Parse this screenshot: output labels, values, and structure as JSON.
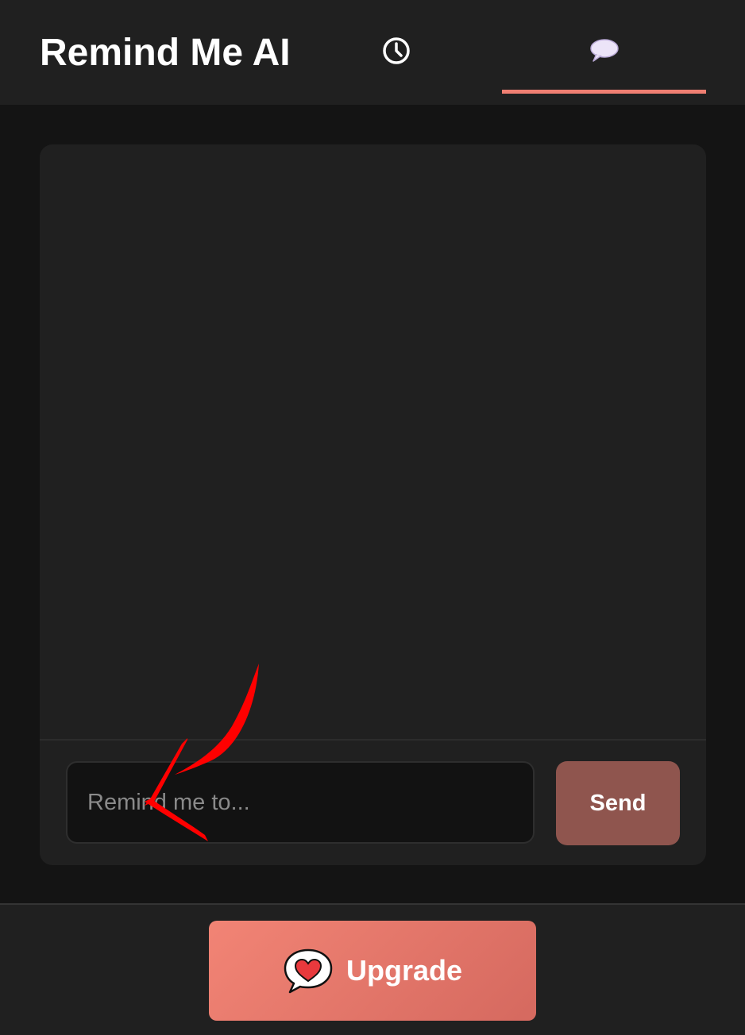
{
  "header": {
    "title": "Remind Me AI",
    "tabs": [
      {
        "icon": "clock-icon",
        "active": false
      },
      {
        "icon": "speech-bubble-icon",
        "active": true
      }
    ]
  },
  "chat": {
    "input_placeholder": "Remind me to...",
    "input_value": "",
    "send_label": "Send"
  },
  "footer": {
    "upgrade_label": "Upgrade",
    "upgrade_icon": "heart-speech-bubble-icon"
  },
  "colors": {
    "accent": "#f07f72",
    "send_button": "#8f554e",
    "background": "#141414",
    "surface": "#202020",
    "annotation_arrow": "#ff0000"
  }
}
